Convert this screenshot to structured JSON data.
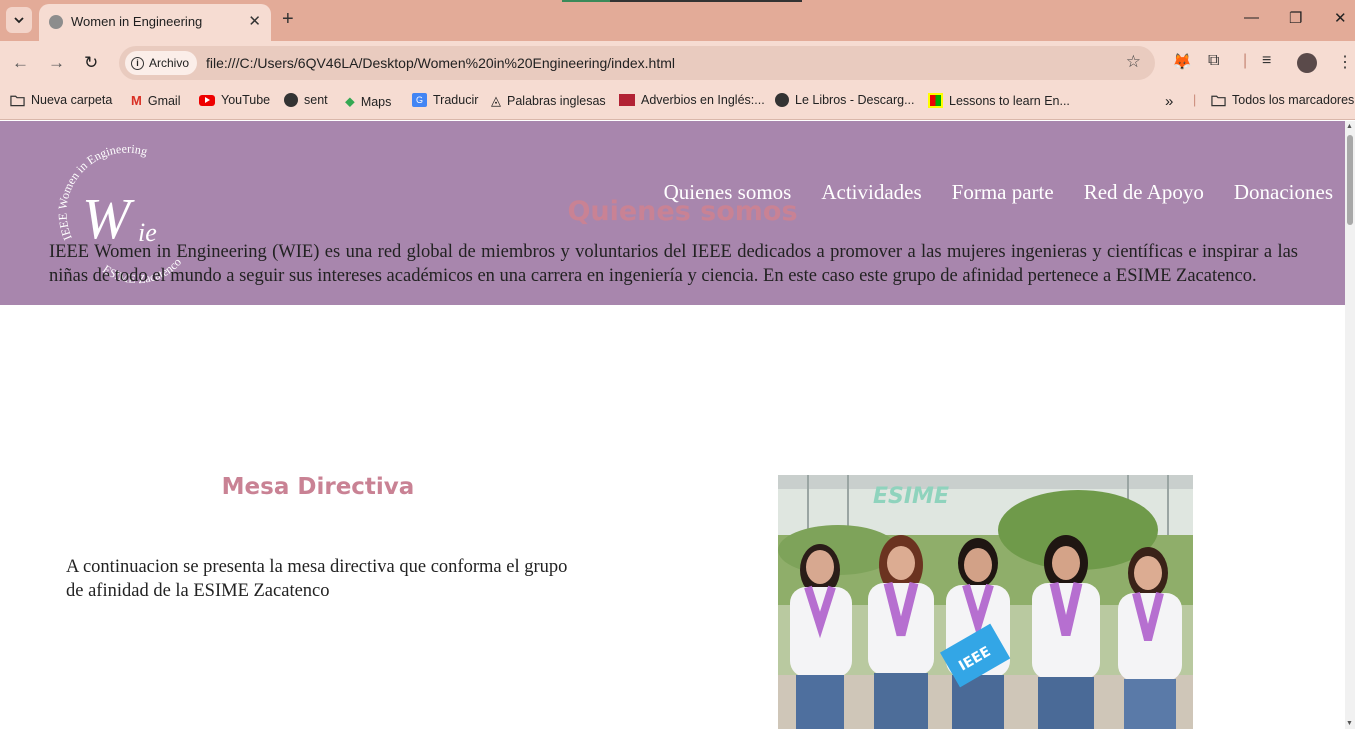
{
  "browser": {
    "tab_title": "Women in Engineering",
    "chip_label": "Archivo",
    "url": "file:///C:/Users/6QV46LA/Desktop/Women%20in%20Engineering/index.html",
    "bookmarks": [
      {
        "label": "Nueva carpeta",
        "icon": "folder-icon"
      },
      {
        "label": "Gmail",
        "icon": "gmail-icon"
      },
      {
        "label": "YouTube",
        "icon": "youtube-icon"
      },
      {
        "label": "sent",
        "icon": "globe-icon"
      },
      {
        "label": "Maps",
        "icon": "maps-icon"
      },
      {
        "label": "Traducir",
        "icon": "translate-icon"
      },
      {
        "label": "Palabras inglesas",
        "icon": "bookmark-icon"
      },
      {
        "label": "Adverbios en Inglés:...",
        "icon": "flag-icon"
      },
      {
        "label": "Le Libros - Descarg...",
        "icon": "globe-icon"
      },
      {
        "label": "Lessons to learn En...",
        "icon": "grid-icon"
      }
    ],
    "all_bookmarks": "Todos los marcadores",
    "more_symbol": "»"
  },
  "logo": {
    "top_text": "IEEE Women in Engineering",
    "monogram": "WIE",
    "bottom_text": "ESIME Zacatenco"
  },
  "nav": {
    "items": [
      "Quienes somos",
      "Actividades",
      "Forma parte",
      "Red de Apoyo",
      "Donaciones"
    ]
  },
  "quienes": {
    "title": "Quienes somos",
    "text": "IEEE Women in Engineering (WIE) es una red global de miembros y voluntarios del IEEE dedicados a promover a las mujeres ingenieras y científicas e inspirar a las niñas de todo el mundo a seguir sus intereses académicos en una carrera en ingeniería y ciencia. En este caso este grupo de afinidad pertenece a ESIME Zacatenco."
  },
  "mesa": {
    "title": "Mesa Directiva",
    "text": "A continuacion se presenta la mesa directiva que conforma el grupo de afinidad de la ESIME Zacatenco"
  },
  "photo": {
    "sign_text": "ESIME",
    "flag_text": "IEEE"
  },
  "colors": {
    "tabstrip": "#e3ab98",
    "toolbar": "#f6dcd2",
    "header": "#a886ad",
    "heading": "#c98294"
  }
}
